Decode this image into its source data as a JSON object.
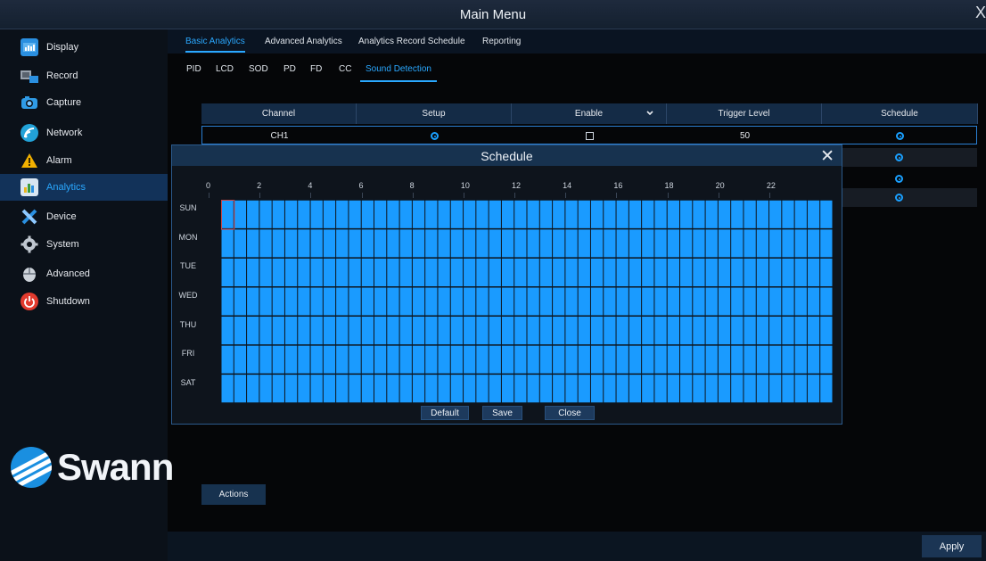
{
  "window": {
    "title": "Main Menu",
    "close": "X"
  },
  "sidebar": {
    "items": [
      {
        "label": "Display",
        "icon": "display-icon",
        "color": "#2a8fe0"
      },
      {
        "label": "Record",
        "icon": "record-icon",
        "color": "#8d97a3"
      },
      {
        "label": "Capture",
        "icon": "camera-icon",
        "color": "#2f9be6"
      },
      {
        "label": "Network",
        "icon": "network-icon",
        "color": "#22a2d8"
      },
      {
        "label": "Alarm",
        "icon": "alarm-icon",
        "color": "#f1b000"
      },
      {
        "label": "Analytics",
        "icon": "analytics-icon",
        "color": "#e9b51f",
        "active": true
      },
      {
        "label": "Device",
        "icon": "device-icon",
        "color": "#2a8fe0"
      },
      {
        "label": "System",
        "icon": "system-icon",
        "color": "#b8c0ca"
      },
      {
        "label": "Advanced",
        "icon": "advanced-icon",
        "color": "#b8c0ca"
      },
      {
        "label": "Shutdown",
        "icon": "power-icon",
        "color": "#e23b2e"
      }
    ],
    "logo_text": "Swann"
  },
  "tabs_primary": [
    "Basic Analytics",
    "Advanced Analytics",
    "Analytics Record Schedule",
    "Reporting"
  ],
  "tabs_secondary": [
    "PID",
    "LCD",
    "SOD",
    "PD",
    "FD",
    "CC",
    "Sound Detection"
  ],
  "table": {
    "headers": [
      "Channel",
      "Setup",
      "Enable",
      "Trigger Level",
      "Schedule"
    ],
    "enable_dropdown_icon": "chevron-down-icon",
    "row1": {
      "channel": "CH1",
      "trigger": "50"
    }
  },
  "schedule_dialog": {
    "title": "Schedule",
    "close_icon": "close-icon",
    "hour_labels": [
      "0",
      "2",
      "4",
      "6",
      "8",
      "10",
      "12",
      "14",
      "16",
      "18",
      "20",
      "22"
    ],
    "days": [
      "SUN",
      "MON",
      "TUE",
      "WED",
      "THU",
      "FRI",
      "SAT"
    ],
    "buttons": {
      "default": "Default",
      "save": "Save",
      "close": "Close"
    },
    "fill_color": "#1a9bff"
  },
  "actions_label": "Actions",
  "apply_label": "Apply"
}
